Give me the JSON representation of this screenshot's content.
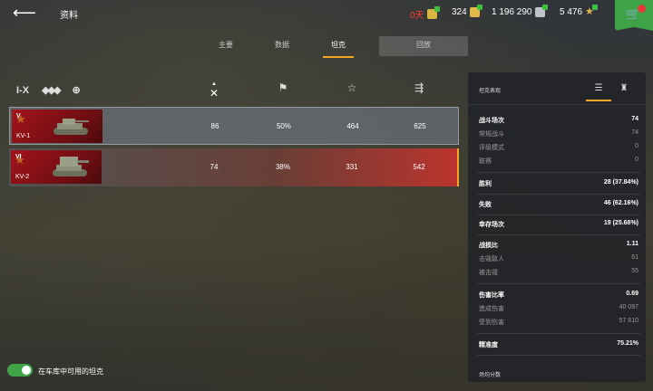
{
  "header": {
    "title": "资料",
    "premium_days": "0天",
    "gold": "324",
    "credits": "1 196 290",
    "free_xp": "5 476"
  },
  "tabs": [
    "主要",
    "数据",
    "坦克",
    "回放"
  ],
  "active_tab": "坦克",
  "filters": {
    "tier": "I-X"
  },
  "tanks": [
    {
      "tier": "V",
      "name": "KV-1",
      "battles": "86",
      "win_rate": "50%",
      "avg_xp": "464",
      "avg_damage": "625"
    },
    {
      "tier": "VI",
      "name": "KV-2",
      "battles": "74",
      "win_rate": "38%",
      "avg_xp": "331",
      "avg_damage": "542"
    }
  ],
  "panel": {
    "title": "坦克表现",
    "stats": [
      {
        "label": "战斗场次",
        "value": "74"
      },
      {
        "label": "常规战斗",
        "value": "74"
      },
      {
        "label": "评级模式",
        "value": "0"
      },
      {
        "label": "联赛",
        "value": "0"
      },
      {
        "label": "胜利",
        "value": "28 (37.84%)"
      },
      {
        "label": "失败",
        "value": "46 (62.16%)"
      },
      {
        "label": "幸存场次",
        "value": "19 (25.68%)"
      },
      {
        "label": "战损比",
        "value": "1.11"
      },
      {
        "label": "击毁敌人",
        "value": "61"
      },
      {
        "label": "被击毁",
        "value": "55"
      },
      {
        "label": "伤害比率",
        "value": "0.69"
      },
      {
        "label": "造成伤害",
        "value": "40 097"
      },
      {
        "label": "受到伤害",
        "value": "57 810"
      },
      {
        "label": "精准度",
        "value": "75.21%"
      }
    ],
    "footer": "场均分数"
  },
  "toggle": {
    "label": "在车库中可用的坦克",
    "on": true
  },
  "colors": {
    "accent": "#f5a623",
    "green": "#3ea447",
    "red": "#d6322d"
  }
}
